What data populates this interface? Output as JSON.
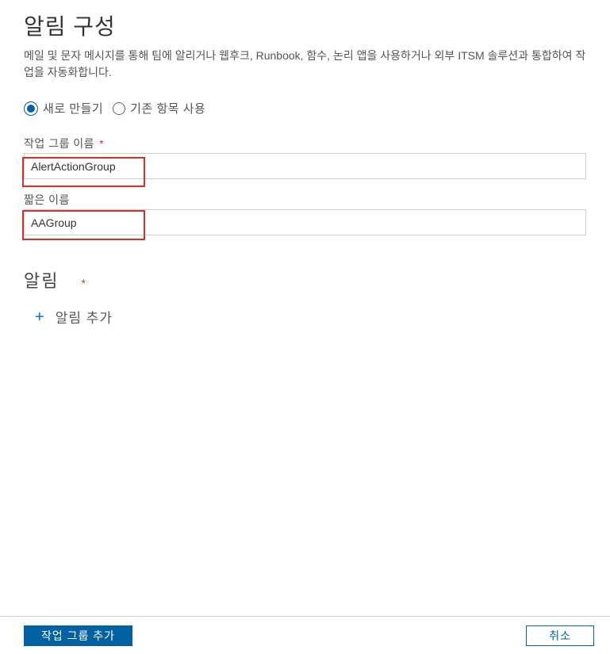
{
  "header": {
    "title": "알림 구성",
    "description": "메일 및 문자 메시지를 통해 팀에 알리거나 웹후크, Runbook, 함수, 논리 앱을 사용하거나 외부 ITSM 솔루션과 통합하여 작업을 자동화합니다."
  },
  "radio": {
    "create_new": "새로 만들기",
    "use_existing": "기존 항목 사용"
  },
  "fields": {
    "action_group_name": {
      "label": "작업 그룹 이름",
      "value": "AlertActionGroup"
    },
    "short_name": {
      "label": "짧은 이름",
      "value": "AAGroup"
    }
  },
  "notifications": {
    "title": "알림",
    "add_label": "알림 추가"
  },
  "footer": {
    "primary": "작업 그룹 추가",
    "cancel": "취소"
  }
}
